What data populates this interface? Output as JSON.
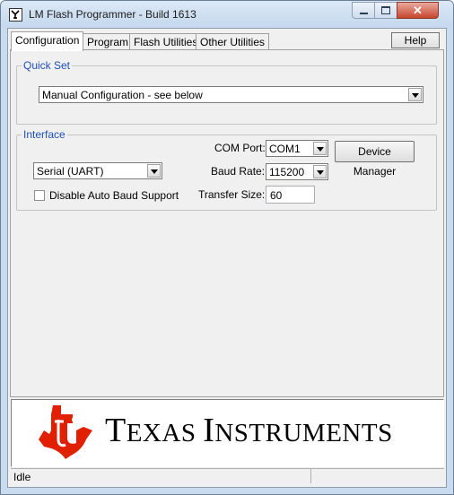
{
  "window": {
    "title": "LM Flash Programmer - Build 1613"
  },
  "tabs": [
    "Configuration",
    "Program",
    "Flash Utilities",
    "Other Utilities"
  ],
  "help_label": "Help",
  "quick_set": {
    "group_label": "Quick Set",
    "selected": "Manual Configuration - see below"
  },
  "interface": {
    "group_label": "Interface",
    "type_selected": "Serial (UART)",
    "disable_auto_baud_label": "Disable Auto Baud Support",
    "disable_auto_baud_checked": false,
    "com_port_label": "COM Port:",
    "com_port_value": "COM1",
    "device_manager_label": "Device Manager",
    "baud_rate_label": "Baud Rate:",
    "baud_rate_value": "115200",
    "transfer_size_label": "Transfer Size:",
    "transfer_size_value": "60"
  },
  "logo": {
    "company": "Texas Instruments",
    "display_big_1": "T",
    "display_small_1": "EXAS ",
    "display_big_2": "I",
    "display_small_2": "NSTRUMENTS",
    "color": "#e02000"
  },
  "status": {
    "text": "Idle"
  }
}
